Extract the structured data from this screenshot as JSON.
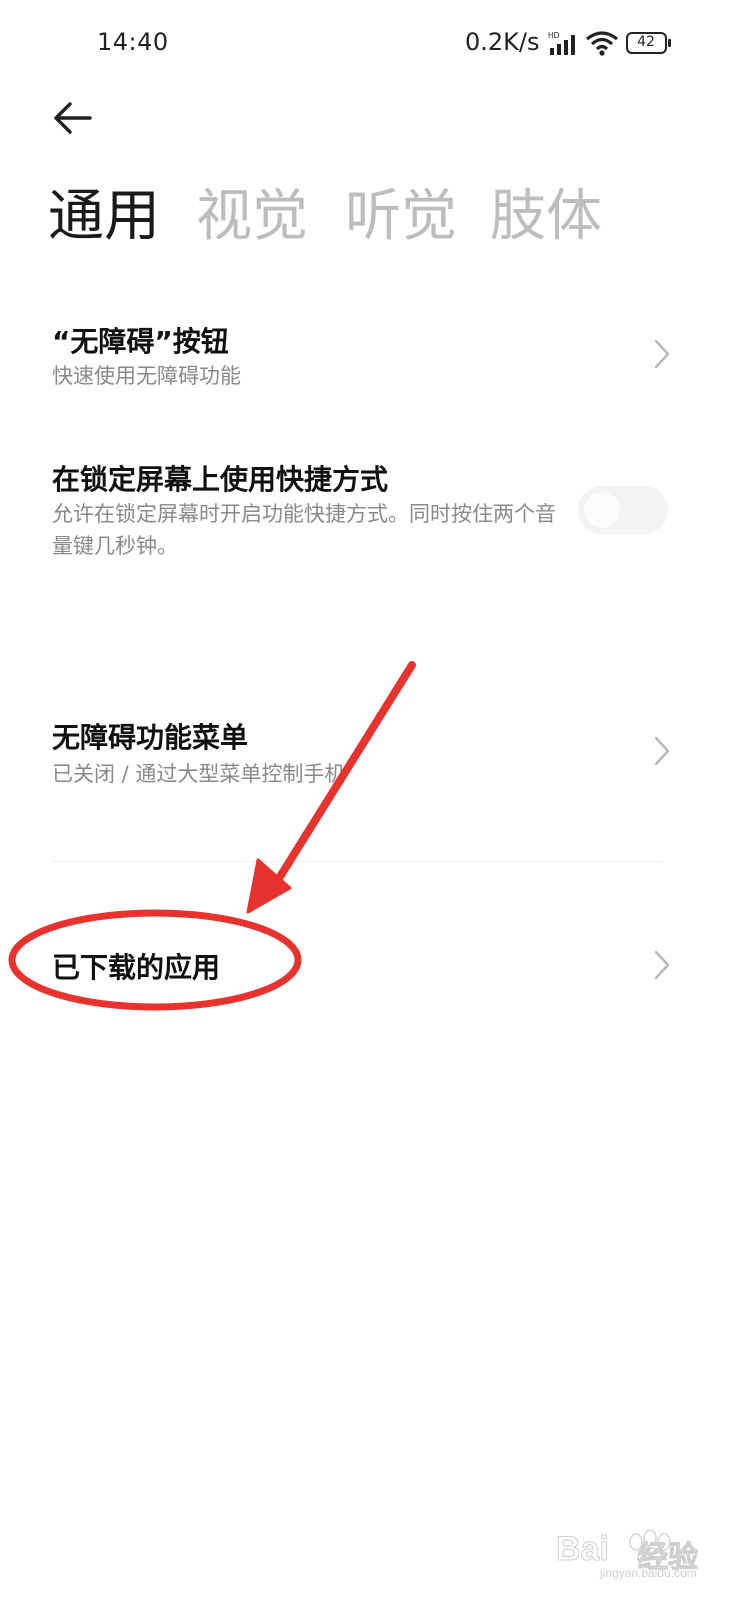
{
  "status_bar": {
    "time": "14:40",
    "net_speed": "0.2K/s",
    "signal_badge": "HD",
    "battery": "42"
  },
  "tabs": [
    {
      "label": "通用",
      "active": true
    },
    {
      "label": "视觉",
      "active": false
    },
    {
      "label": "听觉",
      "active": false
    },
    {
      "label": "肢体",
      "active": false
    }
  ],
  "items": [
    {
      "title": "“无障碍”按钮",
      "subtitle": "快速使用无障碍功能"
    },
    {
      "title": "在锁定屏幕上使用快捷方式",
      "subtitle": "允许在锁定屏幕时开启功能快捷方式。同时按住两个音量键几秒钟。",
      "toggle_on": false
    },
    {
      "title": "无障碍功能菜单",
      "subtitle": "已关闭 / 通过大型菜单控制手机"
    },
    {
      "title": "已下载的应用"
    }
  ],
  "watermark": {
    "brand": "Bai",
    "brand_b": "经验",
    "url": "jingyan.baidu.com"
  },
  "colors": {
    "annotation": "#e8322e",
    "active_tab": "#1a1a1a",
    "inactive_tab": "#bdbdbd"
  },
  "icons": [
    "back-arrow-icon",
    "signal-icon",
    "wifi-icon",
    "battery-icon",
    "chevron-right-icon"
  ]
}
